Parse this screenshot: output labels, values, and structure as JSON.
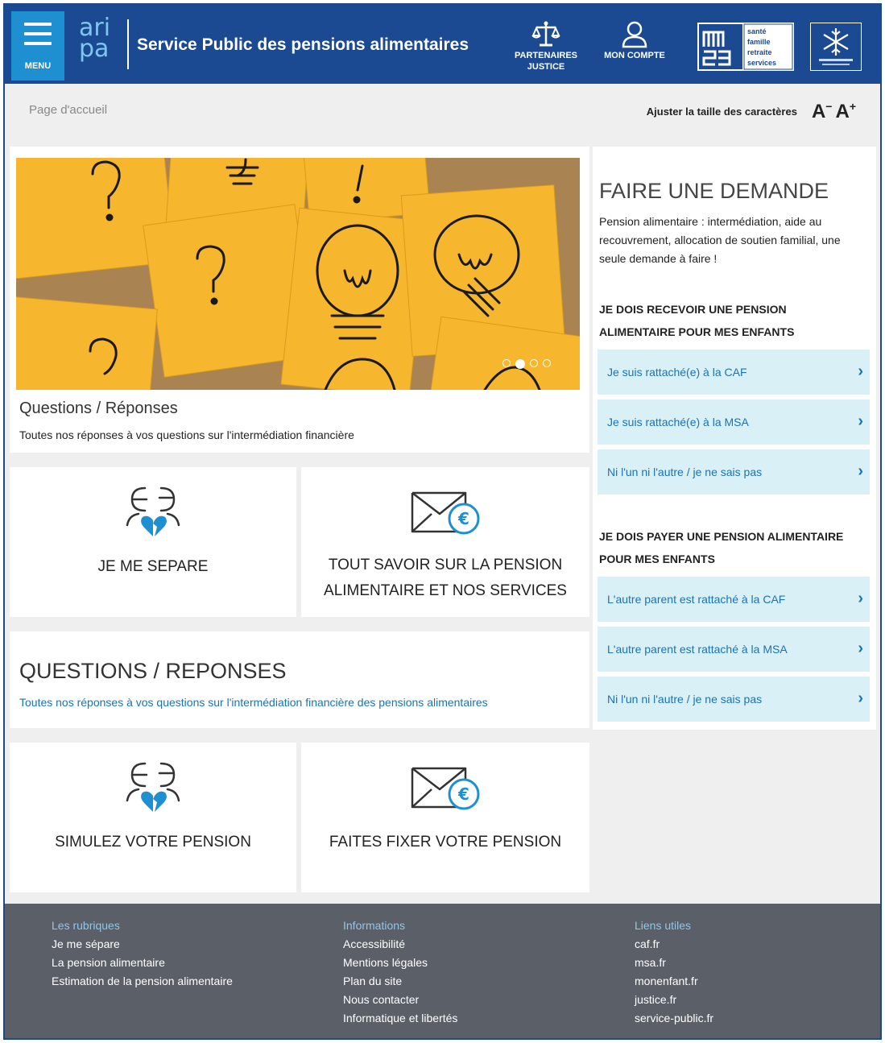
{
  "header": {
    "menu_label": "MENU",
    "logo_text_top": "ari",
    "logo_text_bottom": "pa",
    "site_title": "Service Public des pensions alimentaires",
    "links": [
      {
        "label_1": "PARTENAIRES",
        "label_2": "JUSTICE",
        "icon": "scales-icon"
      },
      {
        "label_1": "MON COMPTE",
        "label_2": "",
        "icon": "user-icon"
      }
    ],
    "msa_logo_lines": [
      "santé",
      "famille",
      "retraite",
      "services"
    ],
    "msa_logo_letters": "msa"
  },
  "breadcrumb": "Page d'accueil",
  "font_adjust": {
    "label": "Ajuster la taille des caractères",
    "decrease": "A",
    "decrease_sup": "−",
    "increase": "A",
    "increase_sup": "+"
  },
  "carousel": {
    "title": "Questions / Réponses",
    "subtitle": "Toutes nos réponses à vos questions sur l'intermédiation financière",
    "slide_count": 4,
    "active_slide": 2
  },
  "tiles": [
    {
      "label": "JE ME SEPARE",
      "icon": "broken-heart-couple-icon"
    },
    {
      "label": "TOUT SAVOIR SUR LA PENSION ALIMENTAIRE ET NOS SERVICES",
      "icon": "euro-envelope-icon"
    },
    {
      "label": "SIMULEZ VOTRE PENSION",
      "icon": "broken-heart-couple-icon"
    },
    {
      "label": "FAITES FIXER VOTRE PENSION",
      "icon": "euro-envelope-icon"
    }
  ],
  "qr_block": {
    "title": "QUESTIONS / REPONSES",
    "subtitle": "Toutes nos réponses à vos questions sur l'intermédiation financière des pensions alimentaires"
  },
  "demande": {
    "title": "FAIRE UNE DEMANDE",
    "description": "Pension alimentaire : intermédiation, aide au recouvrement, allocation de soutien familial, une seule demande à faire !",
    "receive_heading": "JE DOIS RECEVOIR UNE PENSION ALIMENTAIRE POUR MES ENFANTS",
    "receive_links": [
      "Je suis rattaché(e) à la CAF",
      "Je suis rattaché(e) à la MSA",
      "Ni l'un ni l'autre / je ne sais pas"
    ],
    "pay_heading": "JE DOIS PAYER UNE PENSION ALIMENTAIRE POUR MES ENFANTS",
    "pay_links": [
      "L'autre parent est rattaché à la CAF",
      "L'autre parent est rattaché à la MSA",
      "Ni l'un ni l'autre / je ne sais pas"
    ],
    "chevron": "›"
  },
  "footer": {
    "columns": [
      {
        "heading": "Les rubriques",
        "links": [
          "Je me sépare",
          "La pension alimentaire",
          "Estimation de la pension alimentaire"
        ]
      },
      {
        "heading": "Informations",
        "links": [
          "Accessibilité",
          "Mentions légales",
          "Plan du site",
          "Nous contacter",
          "Informatique et libertés"
        ]
      },
      {
        "heading": "Liens utiles",
        "links": [
          "caf.fr",
          "msa.fr",
          "monenfant.fr",
          "justice.fr",
          "service-public.fr"
        ]
      }
    ]
  },
  "colors": {
    "header_bg": "#1b4a92",
    "menu_bg": "#1e8fd0",
    "accent_link": "#1a73b5",
    "link_panel_bg": "#d9f0f6",
    "footer_bg": "#5a5f68"
  }
}
